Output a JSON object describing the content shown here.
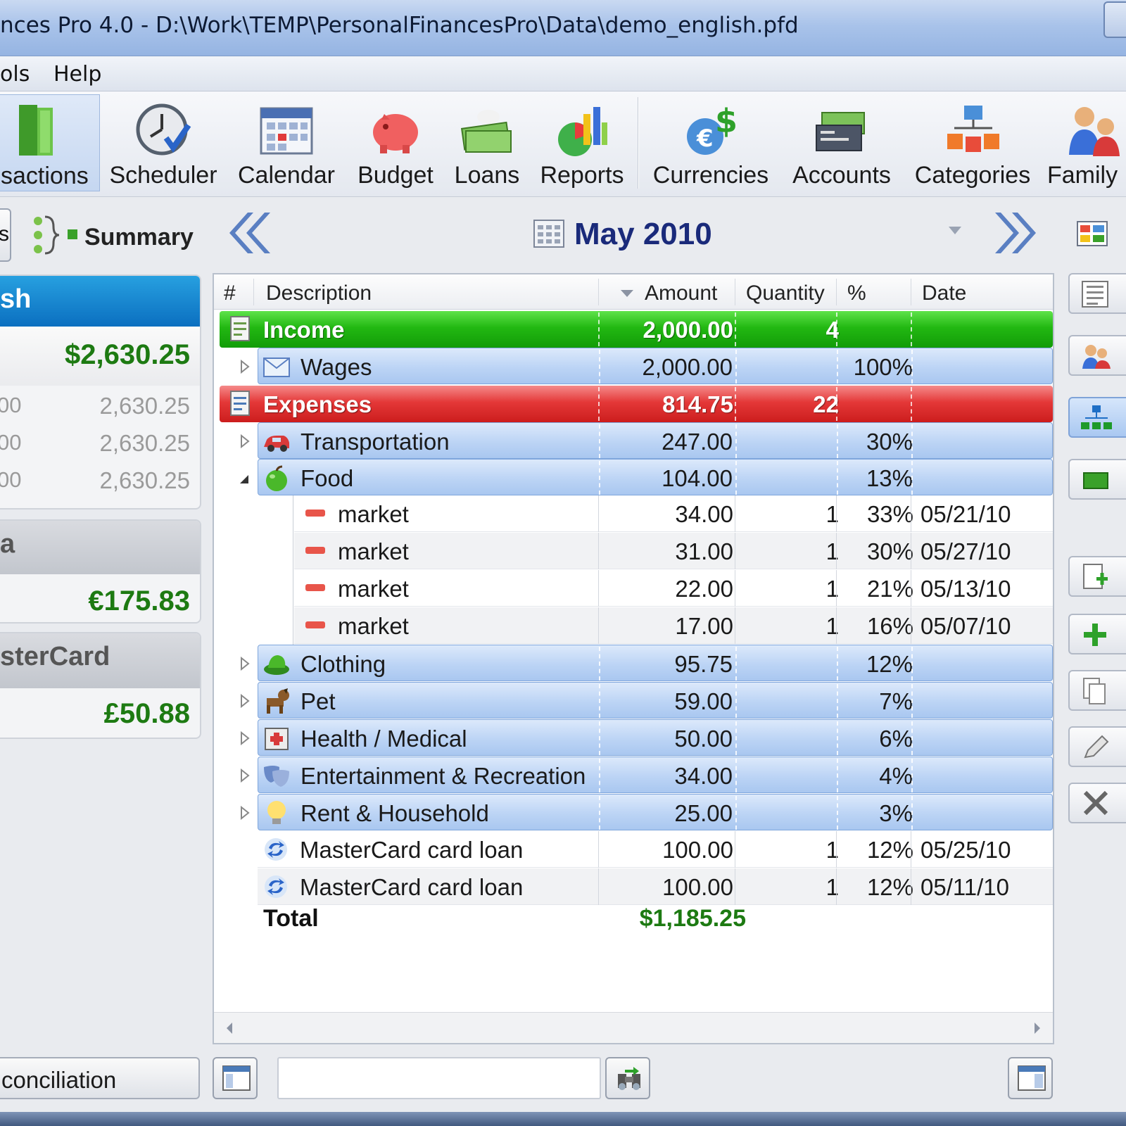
{
  "window": {
    "title": "nces Pro 4.0 - D:\\Work\\TEMP\\PersonalFinancesPro\\Data\\demo_english.pfd"
  },
  "menu": {
    "items": [
      "ols",
      "Help"
    ]
  },
  "toolbar": {
    "buttons": [
      {
        "label": "sactions",
        "icon": "transactions-book-icon"
      },
      {
        "label": "Scheduler",
        "icon": "clock-check-icon"
      },
      {
        "label": "Calendar",
        "icon": "calendar-icon"
      },
      {
        "label": "Budget",
        "icon": "piggy-bank-icon"
      },
      {
        "label": "Loans",
        "icon": "money-hand-icon"
      },
      {
        "label": "Reports",
        "icon": "chart-icon"
      },
      {
        "label": "Currencies",
        "icon": "currency-icon"
      },
      {
        "label": "Accounts",
        "icon": "accounts-icon"
      },
      {
        "label": "Categories",
        "icon": "hierarchy-icon"
      },
      {
        "label": "Family",
        "icon": "family-icon"
      }
    ]
  },
  "left": {
    "tab_stub": "s",
    "summary_label": "Summary",
    "accounts": [
      {
        "name": "sh",
        "balance": "$2,630.25",
        "rows": [
          {
            "left": "00",
            "right": "2,630.25"
          },
          {
            "left": "00",
            "right": "2,630.25"
          },
          {
            "left": "00",
            "right": "2,630.25"
          }
        ]
      },
      {
        "name": "a",
        "balance": "€175.83"
      },
      {
        "name": "sterCard",
        "balance": "£50.88"
      }
    ],
    "reconciliation_label": "conciliation"
  },
  "nav": {
    "month_label": "May 2010"
  },
  "grid": {
    "columns": {
      "num": "#",
      "description": "Description",
      "amount": "Amount",
      "quantity": "Quantity",
      "percent": "%",
      "date": "Date"
    },
    "income": {
      "label": "Income",
      "amount": "2,000.00",
      "quantity": "4"
    },
    "wages": {
      "label": "Wages",
      "amount": "2,000.00",
      "percent": "100%"
    },
    "expenses": {
      "label": "Expenses",
      "amount": "814.75",
      "quantity": "22"
    },
    "transportation": {
      "label": "Transportation",
      "amount": "247.00",
      "percent": "30%"
    },
    "food": {
      "label": "Food",
      "amount": "104.00",
      "percent": "13%"
    },
    "market": [
      {
        "label": "market",
        "amount": "34.00",
        "quantity": "1",
        "percent": "33%",
        "date": "05/21/10"
      },
      {
        "label": "market",
        "amount": "31.00",
        "quantity": "1",
        "percent": "30%",
        "date": "05/27/10"
      },
      {
        "label": "market",
        "amount": "22.00",
        "quantity": "1",
        "percent": "21%",
        "date": "05/13/10"
      },
      {
        "label": "market",
        "amount": "17.00",
        "quantity": "1",
        "percent": "16%",
        "date": "05/07/10"
      }
    ],
    "categories": [
      {
        "label": "Clothing",
        "amount": "95.75",
        "percent": "12%",
        "icon": "hat-icon"
      },
      {
        "label": "Pet",
        "amount": "59.00",
        "percent": "7%",
        "icon": "dog-icon"
      },
      {
        "label": "Health / Medical",
        "amount": "50.00",
        "percent": "6%",
        "icon": "medkit-icon"
      },
      {
        "label": "Entertainment & Recreation",
        "amount": "34.00",
        "percent": "4%",
        "icon": "masks-icon"
      },
      {
        "label": "Rent & Household",
        "amount": "25.00",
        "percent": "3%",
        "icon": "lightbulb-icon"
      }
    ],
    "loans": [
      {
        "label": "MasterCard card loan",
        "amount": "100.00",
        "quantity": "1",
        "percent": "12%",
        "date": "05/25/10"
      },
      {
        "label": "MasterCard card loan",
        "amount": "100.00",
        "quantity": "1",
        "percent": "12%",
        "date": "05/11/10"
      }
    ],
    "total_label": "Total",
    "total_value": "$1,185.25"
  },
  "colors": {
    "income": "#22b812",
    "expense": "#e43838",
    "category": "#bcd4f5",
    "balance_green": "#1d7a12",
    "month_text": "#1a2a7a"
  }
}
